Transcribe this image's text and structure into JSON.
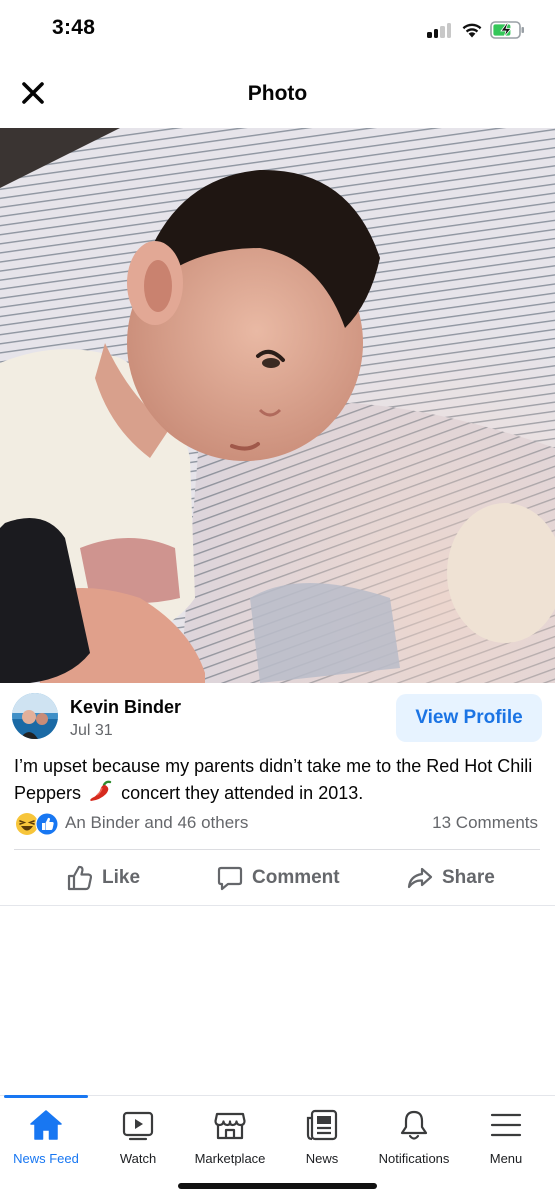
{
  "status_bar": {
    "time": "3:48",
    "icons": [
      "signal-icon",
      "wifi-icon",
      "battery-charging-icon"
    ]
  },
  "header": {
    "title": "Photo",
    "close_icon": "close-icon"
  },
  "photo": {
    "alt": "Toddler lying on a striped pillow"
  },
  "post": {
    "author": "Kevin Binder",
    "date": "Jul 31",
    "view_profile_label": "View Profile",
    "text_before_emoji": "I’m upset because my parents didn’t take me to the Red Hot Chili Peppers",
    "emoji": "hot-pepper-emoji",
    "text_after_emoji": " concert they attended in 2013.",
    "reactions_text": "An Binder and 46 others",
    "reaction_icons": [
      "haha-icon",
      "like-icon"
    ],
    "comments_count": "13 Comments"
  },
  "actions": {
    "like": "Like",
    "comment": "Comment",
    "share": "Share"
  },
  "tabs": [
    {
      "label": "News Feed",
      "icon": "home-icon",
      "active": true
    },
    {
      "label": "Watch",
      "icon": "watch-icon",
      "active": false
    },
    {
      "label": "Marketplace",
      "icon": "marketplace-icon",
      "active": false
    },
    {
      "label": "News",
      "icon": "news-icon",
      "active": false
    },
    {
      "label": "Notifications",
      "icon": "bell-icon",
      "active": false
    },
    {
      "label": "Menu",
      "icon": "menu-icon",
      "active": false
    }
  ],
  "colors": {
    "accent": "#1877f2",
    "view_profile_bg": "#e7f3ff",
    "secondary_text": "#65676b"
  }
}
